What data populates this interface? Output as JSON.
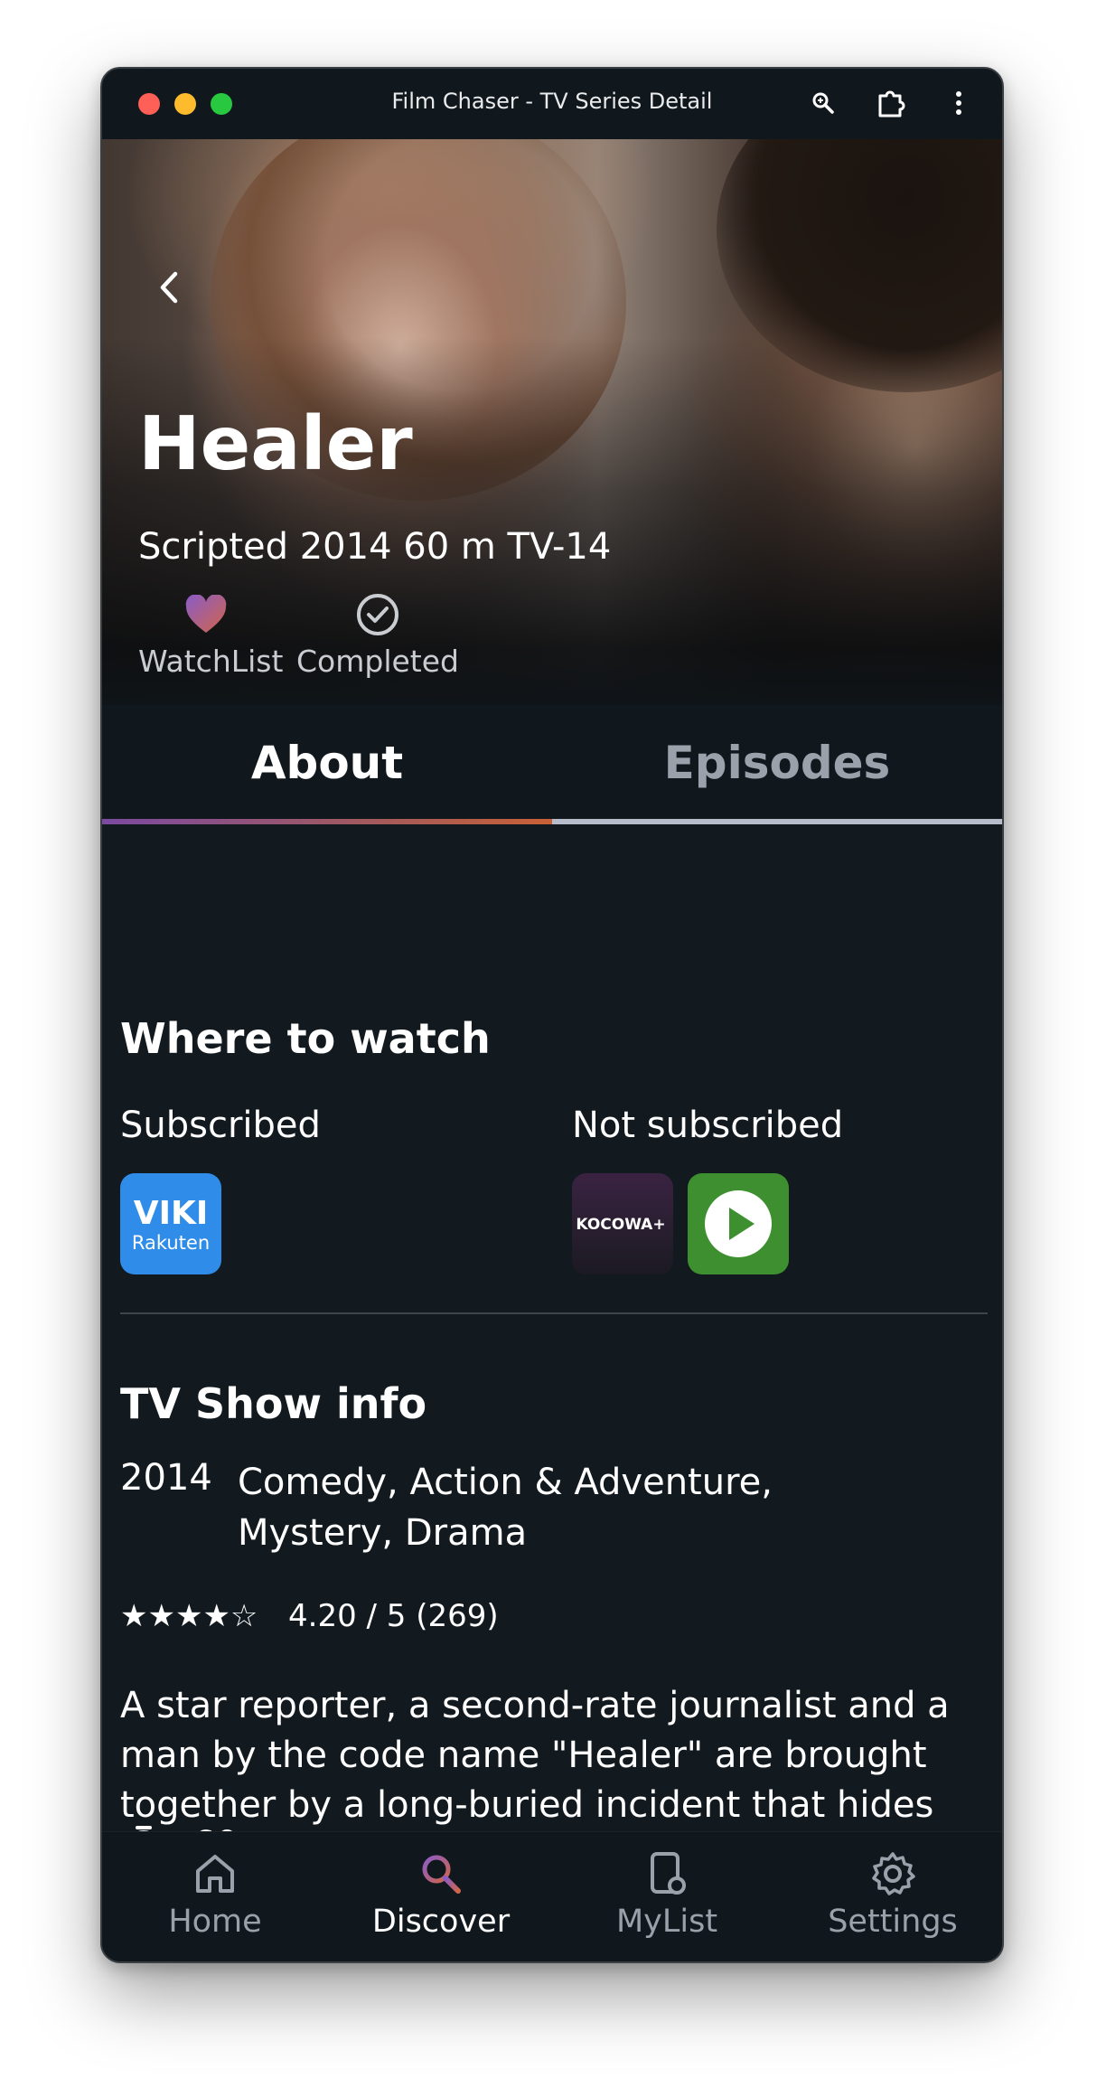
{
  "window": {
    "title": "Film Chaser - TV Series Detail"
  },
  "hero": {
    "title": "Healer",
    "meta": "Scripted 2014 60 m TV-14",
    "actions": [
      {
        "label": "WatchList",
        "icon": "heart-icon"
      },
      {
        "label": "Completed",
        "icon": "check-circle-icon"
      }
    ]
  },
  "tabs": [
    {
      "label": "About",
      "active": true
    },
    {
      "label": "Episodes",
      "active": false
    }
  ],
  "where_to_watch": {
    "heading": "Where to watch",
    "subscribed_label": "Subscribed",
    "subscribed": [
      {
        "name": "Viki Rakuten",
        "logo_text_top": "VIKI",
        "logo_text_bottom": "Rakuten"
      }
    ],
    "not_subscribed_label": "Not subscribed",
    "not_subscribed": [
      {
        "name": "Kocowa+",
        "logo_text": "KOCOWA+"
      },
      {
        "name": "Play",
        "icon": "play-icon"
      }
    ]
  },
  "show_info": {
    "heading": "TV Show info",
    "year": "2014",
    "genres": "Comedy, Action & Adventure, Mystery, Drama",
    "stars": "★★★★☆",
    "rating": 4.2,
    "rating_text": "4.20 / 5 (269)",
    "description": "A star reporter, a second-rate journalist and a man by the code name \"Healer\" are brought together by a long-buried incident that hides dark truths.",
    "runtime": "60m"
  },
  "bottom_nav": [
    {
      "label": "Home",
      "icon": "home-icon",
      "active": false
    },
    {
      "label": "Discover",
      "icon": "search-icon",
      "active": true
    },
    {
      "label": "MyList",
      "icon": "mylist-icon",
      "active": false
    },
    {
      "label": "Settings",
      "icon": "gear-icon",
      "active": false
    }
  ],
  "colors": {
    "background": "#131a1f",
    "accent_gradient_start": "#7b4aa0",
    "accent_gradient_end": "#c86036",
    "inactive_text": "#9aa1ab"
  }
}
